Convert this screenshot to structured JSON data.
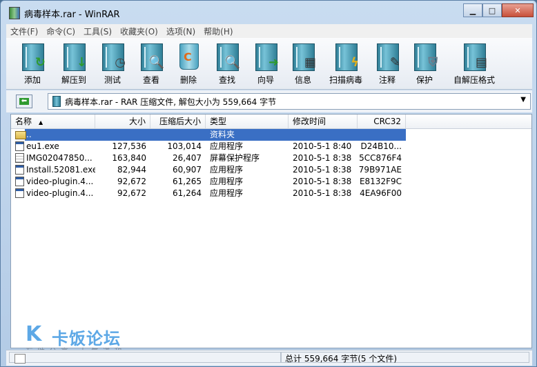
{
  "window": {
    "title": "病毒样本.rar - WinRAR",
    "minimize": "▁",
    "maximize": "□",
    "close": "✕"
  },
  "menu": [
    "文件(F)",
    "命令(C)",
    "工具(S)",
    "收藏夹(O)",
    "选项(N)",
    "帮助(H)"
  ],
  "toolbar": [
    {
      "label": "添加",
      "icon": "add-archive-icon"
    },
    {
      "label": "解压到",
      "icon": "extract-to-icon"
    },
    {
      "label": "测试",
      "icon": "test-icon"
    },
    {
      "label": "查看",
      "icon": "view-icon"
    },
    {
      "label": "删除",
      "icon": "delete-icon"
    },
    {
      "label": "查找",
      "icon": "find-icon"
    },
    {
      "label": "向导",
      "icon": "wizard-icon"
    },
    {
      "label": "信息",
      "icon": "info-icon"
    },
    {
      "label": "扫描病毒",
      "icon": "virus-scan-icon"
    },
    {
      "label": "注释",
      "icon": "comment-icon"
    },
    {
      "label": "保护",
      "icon": "protect-icon"
    },
    {
      "label": "自解压格式",
      "icon": "sfx-icon"
    }
  ],
  "address": {
    "text": "病毒样本.rar - RAR 压缩文件, 解包大小为 559,664 字节",
    "up_glyph": "⬅"
  },
  "columns": {
    "name": "名称",
    "size": "大小",
    "packed": "压缩后大小",
    "type": "类型",
    "modified": "修改时间",
    "crc": "CRC32"
  },
  "files": [
    {
      "name": "..",
      "size": "",
      "packed": "",
      "type": "资料夹",
      "modified": "",
      "crc": "",
      "icon": "folder",
      "selected": true
    },
    {
      "name": "eu1.exe",
      "size": "127,536",
      "packed": "103,014",
      "type": "应用程序",
      "modified": "2010-5-1 8:40",
      "crc": "D24B10...",
      "icon": "app",
      "selected": false
    },
    {
      "name": "IMG02047850...",
      "size": "163,840",
      "packed": "26,407",
      "type": "屏幕保护程序",
      "modified": "2010-5-1 8:38",
      "crc": "5CC876F4",
      "icon": "doc",
      "selected": false
    },
    {
      "name": "Install.52081.exe",
      "size": "82,944",
      "packed": "60,907",
      "type": "应用程序",
      "modified": "2010-5-1 8:38",
      "crc": "79B971AE",
      "icon": "app",
      "selected": false
    },
    {
      "name": "video-plugin.4...",
      "size": "92,672",
      "packed": "61,265",
      "type": "应用程序",
      "modified": "2010-5-1 8:38",
      "crc": "E8132F9C",
      "icon": "app",
      "selected": false
    },
    {
      "name": "video-plugin.4...",
      "size": "92,672",
      "packed": "61,264",
      "type": "应用程序",
      "modified": "2010-5-1 8:38",
      "crc": "4EA96F00",
      "icon": "app",
      "selected": false
    }
  ],
  "status": {
    "text": "总计 559,664 字节(5 个文件)"
  },
  "watermark": {
    "logo": "K",
    "name": "卡饭论坛",
    "slogan": "互助分享 大气谦和",
    "color": "#5da8e6"
  }
}
